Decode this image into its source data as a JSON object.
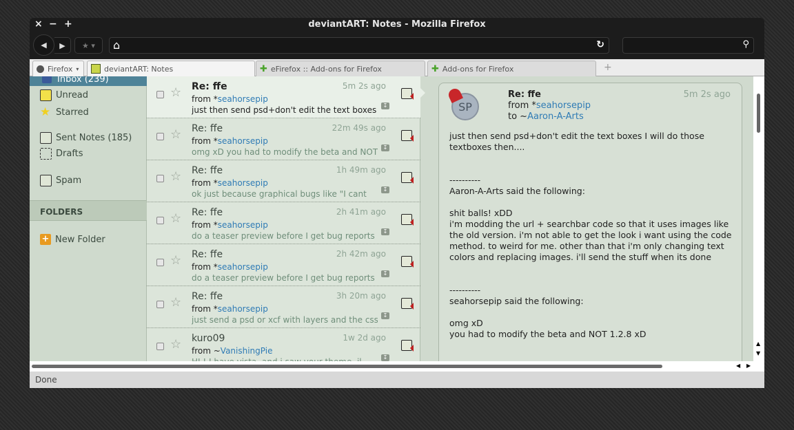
{
  "window": {
    "title": "deviantART: Notes - Mozilla Firefox"
  },
  "tabs": [
    {
      "label": "Firefox"
    },
    {
      "label": "deviantART: Notes"
    },
    {
      "label": "eFirefox :: Add-ons for Firefox"
    },
    {
      "label": "Add-ons for Firefox"
    }
  ],
  "sidebar": {
    "items": [
      {
        "label": "Inbox (239)"
      },
      {
        "label": "Unread"
      },
      {
        "label": "Starred"
      },
      {
        "label": "Sent Notes (185)"
      },
      {
        "label": "Drafts"
      },
      {
        "label": "Spam"
      }
    ],
    "folders_header": "FOLDERS",
    "new_folder": "New Folder"
  },
  "notes": [
    {
      "subject": "Re: ffe",
      "time": "5m 2s ago",
      "from_prefix": "from *",
      "from": "seahorsepip",
      "preview": "just then send psd+don't edit the text boxes"
    },
    {
      "subject": "Re: ffe",
      "time": "22m 49s ago",
      "from_prefix": "from *",
      "from": "seahorsepip",
      "preview": "omg xD you had to modify the beta and NOT"
    },
    {
      "subject": "Re: ffe",
      "time": "1h 49m ago",
      "from_prefix": "from *",
      "from": "seahorsepip",
      "preview": "ok just because graphical bugs like \"I cant"
    },
    {
      "subject": "Re: ffe",
      "time": "2h 41m ago",
      "from_prefix": "from *",
      "from": "seahorsepip",
      "preview": "do a teaser preview before I get bug reports"
    },
    {
      "subject": "Re: ffe",
      "time": "2h 42m ago",
      "from_prefix": "from *",
      "from": "seahorsepip",
      "preview": "do a teaser preview before I get bug reports"
    },
    {
      "subject": "Re: ffe",
      "time": "3h 20m ago",
      "from_prefix": "from *",
      "from": "seahorsepip",
      "preview": "just send a psd or xcf with layers and the css"
    },
    {
      "subject": "kuro09",
      "time": "1w 2d ago",
      "from_prefix": "from ~",
      "from": "VanishingPie",
      "preview": "HI ! I have vista, and i saw your theme, il"
    }
  ],
  "reader": {
    "avatar": "SP",
    "subject": "Re: ffe",
    "time": "5m 2s ago",
    "from_prefix": "from *",
    "from": "seahorsepip",
    "to_prefix": "to ~",
    "to": "Aaron-A-Arts",
    "body": "just then send psd+don't edit the text boxes I will do those textboxes then....\n\n\n----------\nAaron-A-Arts said the following:\n\nshit balls! xDD\ni'm modding the url + searchbar code so that it uses images like the old version. i'm not able to get the look i want using the code method. to weird for me. other than that i'm only changing text colors and replacing images. i'll send the stuff when its done\n\n\n----------\nseahorsepip said the following:\n\nomg xD\nyou had to modify the beta and NOT 1.2.8 xD"
  },
  "status": "Done"
}
